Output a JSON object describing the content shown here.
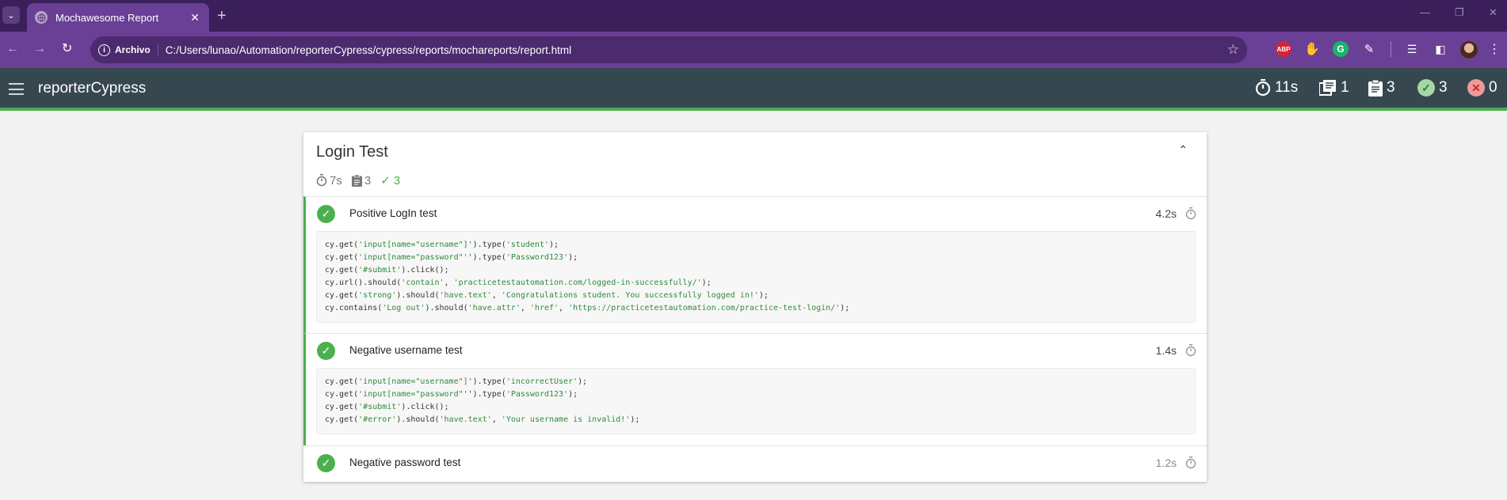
{
  "browser": {
    "tab_title": "Mochawesome Report",
    "new_tab": "+",
    "address_chip": "Archivo",
    "url": "C:/Users/lunao/Automation/reporterCypress/cypress/reports/mochareports/report.html",
    "extensions": [
      "ABP"
    ]
  },
  "app": {
    "title": "reporterCypress",
    "stats": {
      "duration": "11s",
      "suites": "1",
      "tests": "3",
      "passed": "3",
      "failed": "0"
    }
  },
  "suite": {
    "title": "Login Test",
    "duration": "7s",
    "tests": "3",
    "passed": "3",
    "items": [
      {
        "title": "Positive LogIn test",
        "duration": "4.2s",
        "code": [
          [
            {
              "t": "cy.get("
            },
            {
              "t": "'input[name=\"username\"]'",
              "s": 1
            },
            {
              "t": ").type("
            },
            {
              "t": "'student'",
              "s": 1
            },
            {
              "t": ");"
            }
          ],
          [
            {
              "t": "cy.get("
            },
            {
              "t": "'input[name=\"password\"'",
              "s": 1
            },
            {
              "t": "').type("
            },
            {
              "t": "'Password123'",
              "s": 1
            },
            {
              "t": ");"
            }
          ],
          [
            {
              "t": "cy.get("
            },
            {
              "t": "'#submit'",
              "s": 1
            },
            {
              "t": ").click();"
            }
          ],
          [
            {
              "t": "cy.url().should("
            },
            {
              "t": "'contain'",
              "s": 1
            },
            {
              "t": ", "
            },
            {
              "t": "'practicetestautomation.com/logged-in-successfully/'",
              "s": 1
            },
            {
              "t": ");"
            }
          ],
          [
            {
              "t": "cy.get("
            },
            {
              "t": "'strong'",
              "s": 1
            },
            {
              "t": ").should("
            },
            {
              "t": "'have.text'",
              "s": 1
            },
            {
              "t": ", "
            },
            {
              "t": "'Congratulations student. You successfully logged in!'",
              "s": 1
            },
            {
              "t": ");"
            }
          ],
          [
            {
              "t": "cy.contains("
            },
            {
              "t": "'Log out'",
              "s": 1
            },
            {
              "t": ").should("
            },
            {
              "t": "'have.attr'",
              "s": 1
            },
            {
              "t": ", "
            },
            {
              "t": "'href'",
              "s": 1
            },
            {
              "t": ", "
            },
            {
              "t": "'https://practicetestautomation.com/practice-test-login/'",
              "s": 1
            },
            {
              "t": ");"
            }
          ]
        ]
      },
      {
        "title": "Negative username test",
        "duration": "1.4s",
        "code": [
          [
            {
              "t": "cy.get("
            },
            {
              "t": "'input[name=\"username\"]'",
              "s": 1
            },
            {
              "t": ").type("
            },
            {
              "t": "'incorrectUser'",
              "s": 1
            },
            {
              "t": ");"
            }
          ],
          [
            {
              "t": "cy.get("
            },
            {
              "t": "'input[name=\"password\"'",
              "s": 1
            },
            {
              "t": "').type("
            },
            {
              "t": "'Password123'",
              "s": 1
            },
            {
              "t": ");"
            }
          ],
          [
            {
              "t": "cy.get("
            },
            {
              "t": "'#submit'",
              "s": 1
            },
            {
              "t": ").click();"
            }
          ],
          [
            {
              "t": "cy.get("
            },
            {
              "t": "'#error'",
              "s": 1
            },
            {
              "t": ").should("
            },
            {
              "t": "'have.text'",
              "s": 1
            },
            {
              "t": ", "
            },
            {
              "t": "'Your username is invalid!'",
              "s": 1
            },
            {
              "t": ");"
            }
          ]
        ]
      },
      {
        "title": "Negative password test",
        "duration": "1.2s",
        "code": []
      }
    ]
  },
  "colors": {
    "pass": "#4caf50",
    "appbar": "#37474f",
    "browser_frame": "#6a3f96"
  }
}
